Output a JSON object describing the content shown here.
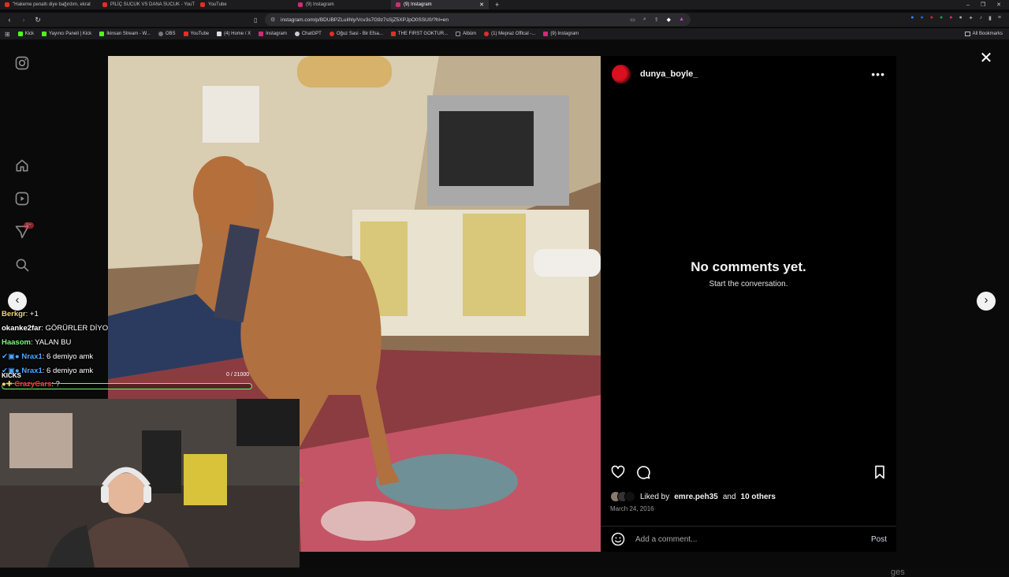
{
  "browser": {
    "tabs": [
      {
        "title": "\"Hakeme penaltı diye bağırdım, ekrat",
        "color": "#e52d27",
        "active": false
      },
      {
        "title": "PİLİÇ SUCUK VS DANA SUCUK - YouT",
        "color": "#e52d27",
        "active": false
      },
      {
        "title": "YouTube",
        "color": "#e52d27",
        "active": false
      },
      {
        "title": "(9) Instagram",
        "color": "#d62976",
        "active": false
      },
      {
        "title": "(9) Instagram",
        "color": "#d62976",
        "active": true
      }
    ],
    "new_tab": "+",
    "url": "instagram.com/p/BDUBPZLuiIhly/Vcv3s7G9z7sSjZ5XPJpO0SSU0/?hl=en",
    "bookmarks": [
      {
        "label": "Kick",
        "color": "#53fc18"
      },
      {
        "label": "Yayıncı Paneli | Kick",
        "color": "#53fc18"
      },
      {
        "label": "Ikinsan Stream - W...",
        "color": "#53fc18"
      },
      {
        "label": "OBS",
        "color": "#777777"
      },
      {
        "label": "YouTube",
        "color": "#e52d27"
      },
      {
        "label": "(4) Home / X",
        "color": "#dddddd"
      },
      {
        "label": "Instagram",
        "color": "#d62976"
      },
      {
        "label": "ChatGPT",
        "color": "#cccccc"
      },
      {
        "label": "Oğuz Sasi - Bir Efsa...",
        "color": "#e52d27"
      },
      {
        "label": "THE FIRST GOKTUR...",
        "color": "#e52d27"
      },
      {
        "label": "Albüm",
        "color": "#888888"
      },
      {
        "label": "(1) Mepraz Offical -...",
        "color": "#e52d27"
      },
      {
        "label": "(9) Instagram",
        "color": "#d62976"
      }
    ],
    "all_bookmarks": "All Bookmarks"
  },
  "instagram": {
    "notification_badge": "9+",
    "post": {
      "username": "dunya_boyle_",
      "empty_title": "No comments yet.",
      "empty_subtitle": "Start the conversation.",
      "liked_prefix": "Liked by",
      "liked_user": "emre.peh35",
      "liked_and": "and",
      "liked_others": "10 others",
      "date": "March 24, 2016",
      "comment_placeholder": "Add a comment...",
      "post_label": "Post"
    },
    "background_text": "ges"
  },
  "overlay": {
    "chat": [
      {
        "user": "Berkgr",
        "message": "+1",
        "color": "#f2d675"
      },
      {
        "user": "okanke2far",
        "message": "GÖRÜRLER DİYO",
        "color": "#ffffff"
      },
      {
        "user": "Haasom",
        "message": "YALAN BU",
        "color": "#7dfc7d"
      },
      {
        "user": "Nrax1",
        "message": "6 demiyo amk",
        "color": "#4ea7ff"
      },
      {
        "user": "Nrax1",
        "message": "6 demiyo amk",
        "color": "#4ea7ff"
      },
      {
        "user": "CrazyCars",
        "message": "?",
        "color": "#ff4040"
      }
    ],
    "kicks_label": "KICKS",
    "kicks_count": "0 / 21000",
    "kicks_progress": 0
  }
}
